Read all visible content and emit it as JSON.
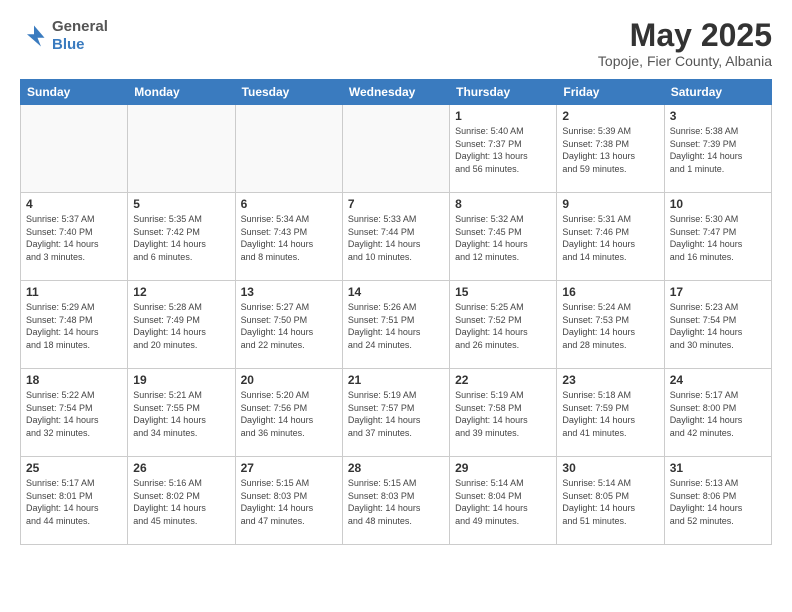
{
  "header": {
    "logo_line1": "General",
    "logo_line2": "Blue",
    "month_title": "May 2025",
    "location": "Topoje, Fier County, Albania"
  },
  "weekdays": [
    "Sunday",
    "Monday",
    "Tuesday",
    "Wednesday",
    "Thursday",
    "Friday",
    "Saturday"
  ],
  "weeks": [
    [
      {
        "day": "",
        "info": ""
      },
      {
        "day": "",
        "info": ""
      },
      {
        "day": "",
        "info": ""
      },
      {
        "day": "",
        "info": ""
      },
      {
        "day": "1",
        "info": "Sunrise: 5:40 AM\nSunset: 7:37 PM\nDaylight: 13 hours\nand 56 minutes."
      },
      {
        "day": "2",
        "info": "Sunrise: 5:39 AM\nSunset: 7:38 PM\nDaylight: 13 hours\nand 59 minutes."
      },
      {
        "day": "3",
        "info": "Sunrise: 5:38 AM\nSunset: 7:39 PM\nDaylight: 14 hours\nand 1 minute."
      }
    ],
    [
      {
        "day": "4",
        "info": "Sunrise: 5:37 AM\nSunset: 7:40 PM\nDaylight: 14 hours\nand 3 minutes."
      },
      {
        "day": "5",
        "info": "Sunrise: 5:35 AM\nSunset: 7:42 PM\nDaylight: 14 hours\nand 6 minutes."
      },
      {
        "day": "6",
        "info": "Sunrise: 5:34 AM\nSunset: 7:43 PM\nDaylight: 14 hours\nand 8 minutes."
      },
      {
        "day": "7",
        "info": "Sunrise: 5:33 AM\nSunset: 7:44 PM\nDaylight: 14 hours\nand 10 minutes."
      },
      {
        "day": "8",
        "info": "Sunrise: 5:32 AM\nSunset: 7:45 PM\nDaylight: 14 hours\nand 12 minutes."
      },
      {
        "day": "9",
        "info": "Sunrise: 5:31 AM\nSunset: 7:46 PM\nDaylight: 14 hours\nand 14 minutes."
      },
      {
        "day": "10",
        "info": "Sunrise: 5:30 AM\nSunset: 7:47 PM\nDaylight: 14 hours\nand 16 minutes."
      }
    ],
    [
      {
        "day": "11",
        "info": "Sunrise: 5:29 AM\nSunset: 7:48 PM\nDaylight: 14 hours\nand 18 minutes."
      },
      {
        "day": "12",
        "info": "Sunrise: 5:28 AM\nSunset: 7:49 PM\nDaylight: 14 hours\nand 20 minutes."
      },
      {
        "day": "13",
        "info": "Sunrise: 5:27 AM\nSunset: 7:50 PM\nDaylight: 14 hours\nand 22 minutes."
      },
      {
        "day": "14",
        "info": "Sunrise: 5:26 AM\nSunset: 7:51 PM\nDaylight: 14 hours\nand 24 minutes."
      },
      {
        "day": "15",
        "info": "Sunrise: 5:25 AM\nSunset: 7:52 PM\nDaylight: 14 hours\nand 26 minutes."
      },
      {
        "day": "16",
        "info": "Sunrise: 5:24 AM\nSunset: 7:53 PM\nDaylight: 14 hours\nand 28 minutes."
      },
      {
        "day": "17",
        "info": "Sunrise: 5:23 AM\nSunset: 7:54 PM\nDaylight: 14 hours\nand 30 minutes."
      }
    ],
    [
      {
        "day": "18",
        "info": "Sunrise: 5:22 AM\nSunset: 7:54 PM\nDaylight: 14 hours\nand 32 minutes."
      },
      {
        "day": "19",
        "info": "Sunrise: 5:21 AM\nSunset: 7:55 PM\nDaylight: 14 hours\nand 34 minutes."
      },
      {
        "day": "20",
        "info": "Sunrise: 5:20 AM\nSunset: 7:56 PM\nDaylight: 14 hours\nand 36 minutes."
      },
      {
        "day": "21",
        "info": "Sunrise: 5:19 AM\nSunset: 7:57 PM\nDaylight: 14 hours\nand 37 minutes."
      },
      {
        "day": "22",
        "info": "Sunrise: 5:19 AM\nSunset: 7:58 PM\nDaylight: 14 hours\nand 39 minutes."
      },
      {
        "day": "23",
        "info": "Sunrise: 5:18 AM\nSunset: 7:59 PM\nDaylight: 14 hours\nand 41 minutes."
      },
      {
        "day": "24",
        "info": "Sunrise: 5:17 AM\nSunset: 8:00 PM\nDaylight: 14 hours\nand 42 minutes."
      }
    ],
    [
      {
        "day": "25",
        "info": "Sunrise: 5:17 AM\nSunset: 8:01 PM\nDaylight: 14 hours\nand 44 minutes."
      },
      {
        "day": "26",
        "info": "Sunrise: 5:16 AM\nSunset: 8:02 PM\nDaylight: 14 hours\nand 45 minutes."
      },
      {
        "day": "27",
        "info": "Sunrise: 5:15 AM\nSunset: 8:03 PM\nDaylight: 14 hours\nand 47 minutes."
      },
      {
        "day": "28",
        "info": "Sunrise: 5:15 AM\nSunset: 8:03 PM\nDaylight: 14 hours\nand 48 minutes."
      },
      {
        "day": "29",
        "info": "Sunrise: 5:14 AM\nSunset: 8:04 PM\nDaylight: 14 hours\nand 49 minutes."
      },
      {
        "day": "30",
        "info": "Sunrise: 5:14 AM\nSunset: 8:05 PM\nDaylight: 14 hours\nand 51 minutes."
      },
      {
        "day": "31",
        "info": "Sunrise: 5:13 AM\nSunset: 8:06 PM\nDaylight: 14 hours\nand 52 minutes."
      }
    ]
  ]
}
